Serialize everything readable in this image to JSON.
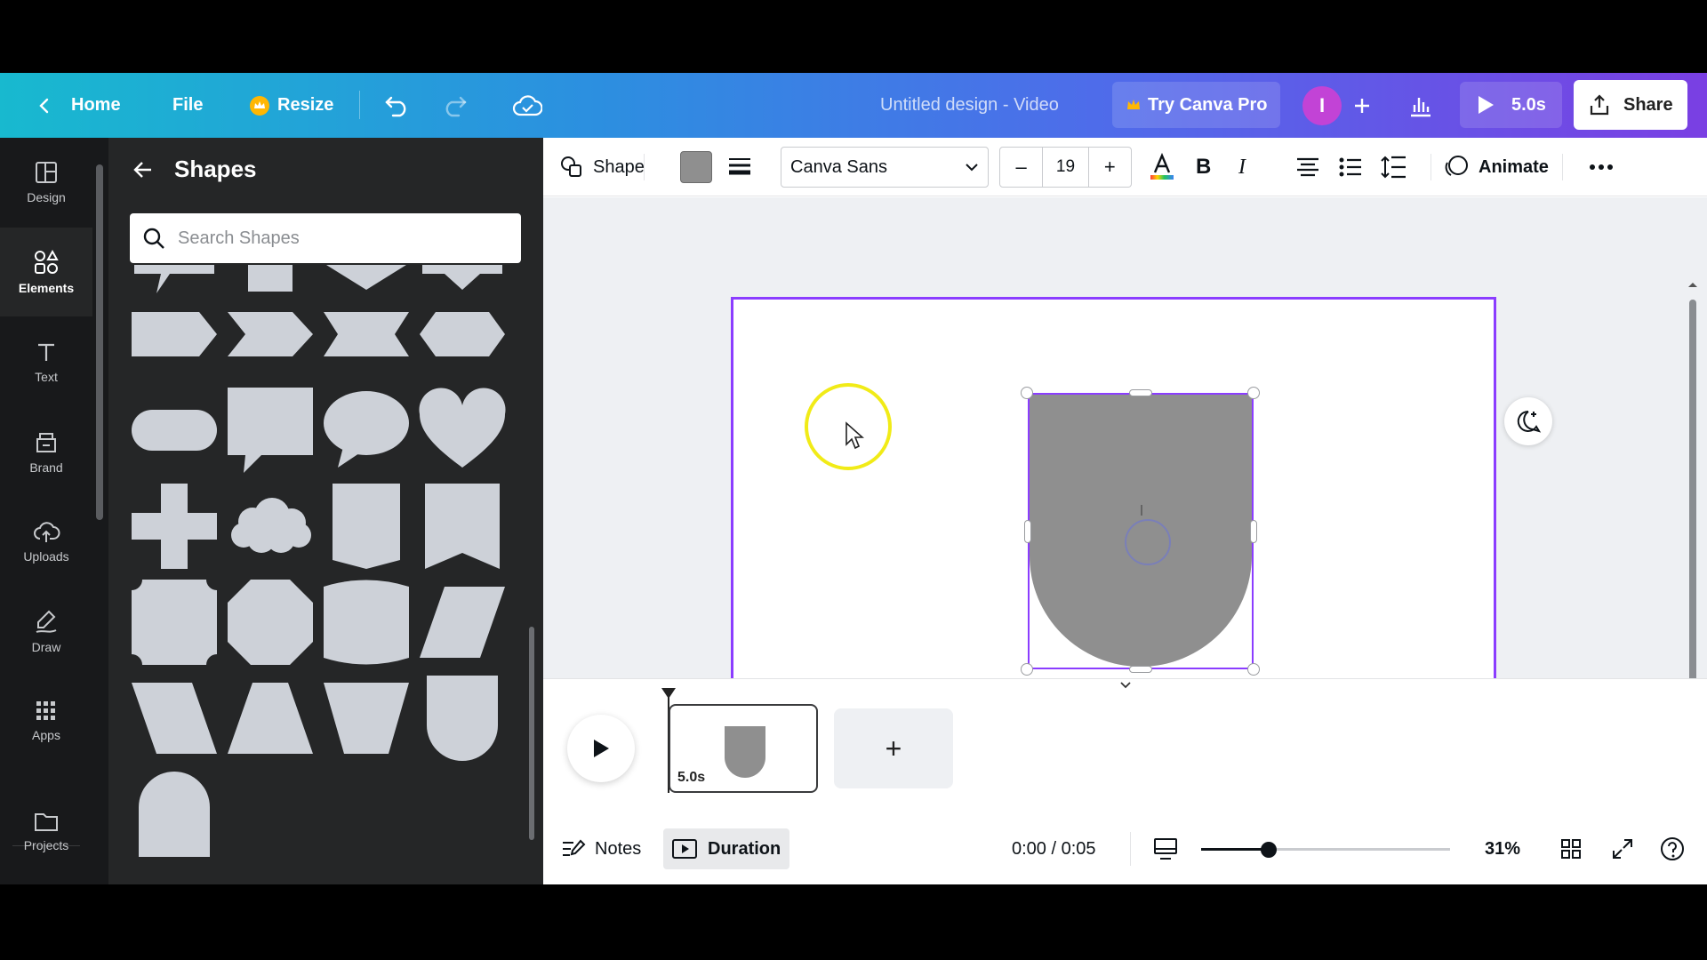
{
  "topbar": {
    "back_label": "Home",
    "file_label": "File",
    "resize_label": "Resize",
    "title": "Untitled design - Video",
    "try_pro_label": "Try Canva Pro",
    "avatar_initial": "I",
    "play_duration": "5.0s",
    "share_label": "Share"
  },
  "rail": {
    "items": [
      {
        "label": "Design"
      },
      {
        "label": "Elements"
      },
      {
        "label": "Text"
      },
      {
        "label": "Brand"
      },
      {
        "label": "Uploads"
      },
      {
        "label": "Draw"
      },
      {
        "label": "Apps"
      },
      {
        "label": "Projects"
      }
    ]
  },
  "panel": {
    "title": "Shapes",
    "search_placeholder": "Search Shapes"
  },
  "toolbar": {
    "shape_label": "Shape",
    "font_name": "Canva Sans",
    "font_size": "19",
    "bold_label": "B",
    "italic_label": "I",
    "animate_label": "Animate"
  },
  "timeline": {
    "clip_duration": "5.0s",
    "notes_label": "Notes",
    "duration_label": "Duration",
    "time_display": "0:00 / 0:05",
    "zoom_level": "31%",
    "zoom_fraction": 0.27
  },
  "colors": {
    "accent": "#8b3dff",
    "shape_fill": "#8f8f8f",
    "panel_shape_fill": "#cdd1d8",
    "cursor_ring": "#f1eb17"
  }
}
